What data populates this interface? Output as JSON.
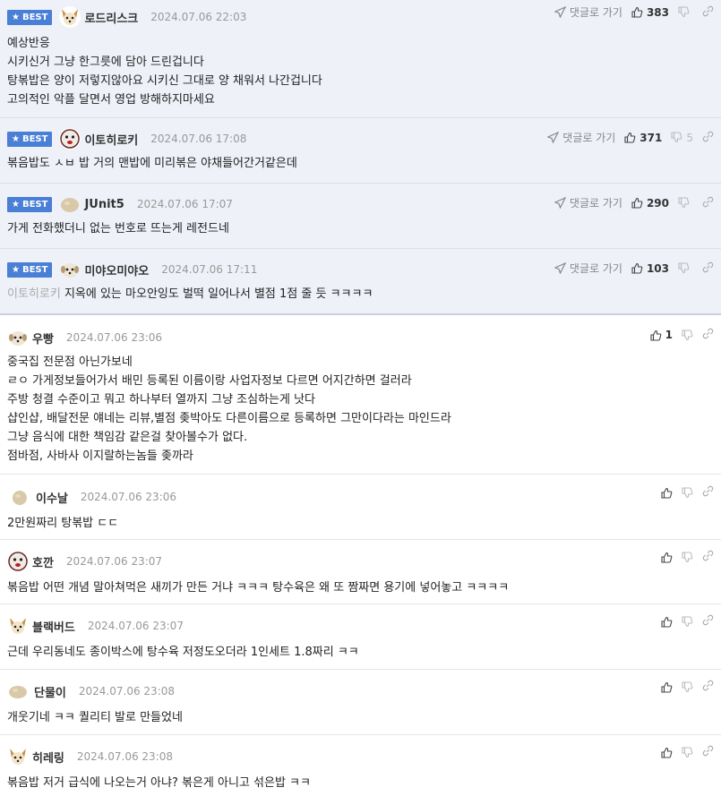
{
  "ui": {
    "best_label": "BEST",
    "reply_label": "댓글로 가기"
  },
  "best_comments": [
    {
      "nick": "로드리스크",
      "date": "2024.07.06 22:03",
      "likes": "383",
      "dislikes": "",
      "avatar": "dog-face",
      "text": "예상반응\n시키신거 그냥 한그릇에 담아 드린겁니다\n탕볶밥은 양이 저렇지않아요 시키신 그대로 양 채워서 나간겁니다\n고의적인 악플 달면서 영업 방해하지마세요"
    },
    {
      "nick": "이토히로키",
      "date": "2024.07.06 17:08",
      "likes": "371",
      "dislikes": "5",
      "avatar": "clown-face",
      "text": "볶음밥도 ㅅㅂ 밥 거의 맨밥에 미리볶은 야채들어간거같은데"
    },
    {
      "nick": "JUnit5",
      "date": "2024.07.06 17:07",
      "likes": "290",
      "dislikes": "",
      "avatar": "round-blob",
      "text": "가게 전화했더니 없는 번호로 뜨는게 레전드네"
    },
    {
      "nick": "미야오미야오",
      "date": "2024.07.06 17:11",
      "likes": "103",
      "dislikes": "",
      "avatar": "puppy-face",
      "mention": "이토히로키",
      "text": "지옥에 있는 마오안잉도 벌떡 일어나서 별점 1점 줄 듯 ㅋㅋㅋㅋ"
    }
  ],
  "comments": [
    {
      "nick": "우빵",
      "date": "2024.07.06 23:06",
      "likes": "1",
      "avatar": "puppy-face",
      "text": "중국집 전문점 아닌가보네\nㄹㅇ 가게정보들어가서 배민 등록된 이름이랑 사업자정보 다르면 어지간하면 걸러라\n주방 청결 수준이고 뭐고 하나부터 열까지 그냥 조심하는게 낫다\n샵인샵, 배달전문 얘네는 리뷰,별점 좆박아도 다른이름으로 등록하면 그만이다라는 마인드라\n그냥 음식에 대한 책임감 같은걸 찾아볼수가 없다.\n점바점, 사바사 이지랄하는놈들 좆까라"
    },
    {
      "nick": "이수날",
      "date": "2024.07.06 23:06",
      "likes": "",
      "avatar": "round-blob",
      "text": "2만원짜리 탕볶밥 ㄷㄷ"
    },
    {
      "nick": "호깐",
      "date": "2024.07.06 23:07",
      "likes": "",
      "avatar": "clown-face",
      "text": "볶음밥 어떤 개념 말아쳐먹은 새끼가 만든 거냐 ㅋㅋㅋ 탕수육은 왜 또 짬짜면 용기에 넣어놓고 ㅋㅋㅋㅋ"
    },
    {
      "nick": "블랙버드",
      "date": "2024.07.06 23:07",
      "likes": "",
      "avatar": "dog-face",
      "text": "근데 우리동네도 종이박스에 탕수육 저정도오더라 1인세트 1.8짜리 ㅋㅋ"
    },
    {
      "nick": "단물이",
      "date": "2024.07.06 23:08",
      "likes": "",
      "avatar": "round-blob",
      "text": "개웃기네 ㅋㅋ 퀄리티 발로 만들었네"
    },
    {
      "nick": "히레링",
      "date": "2024.07.06 23:08",
      "likes": "",
      "avatar": "dog-face",
      "text": "볶음밥 저거 급식에 나오는거 아냐? 볶은게 아니고 섞은밥 ㅋㅋ"
    }
  ]
}
